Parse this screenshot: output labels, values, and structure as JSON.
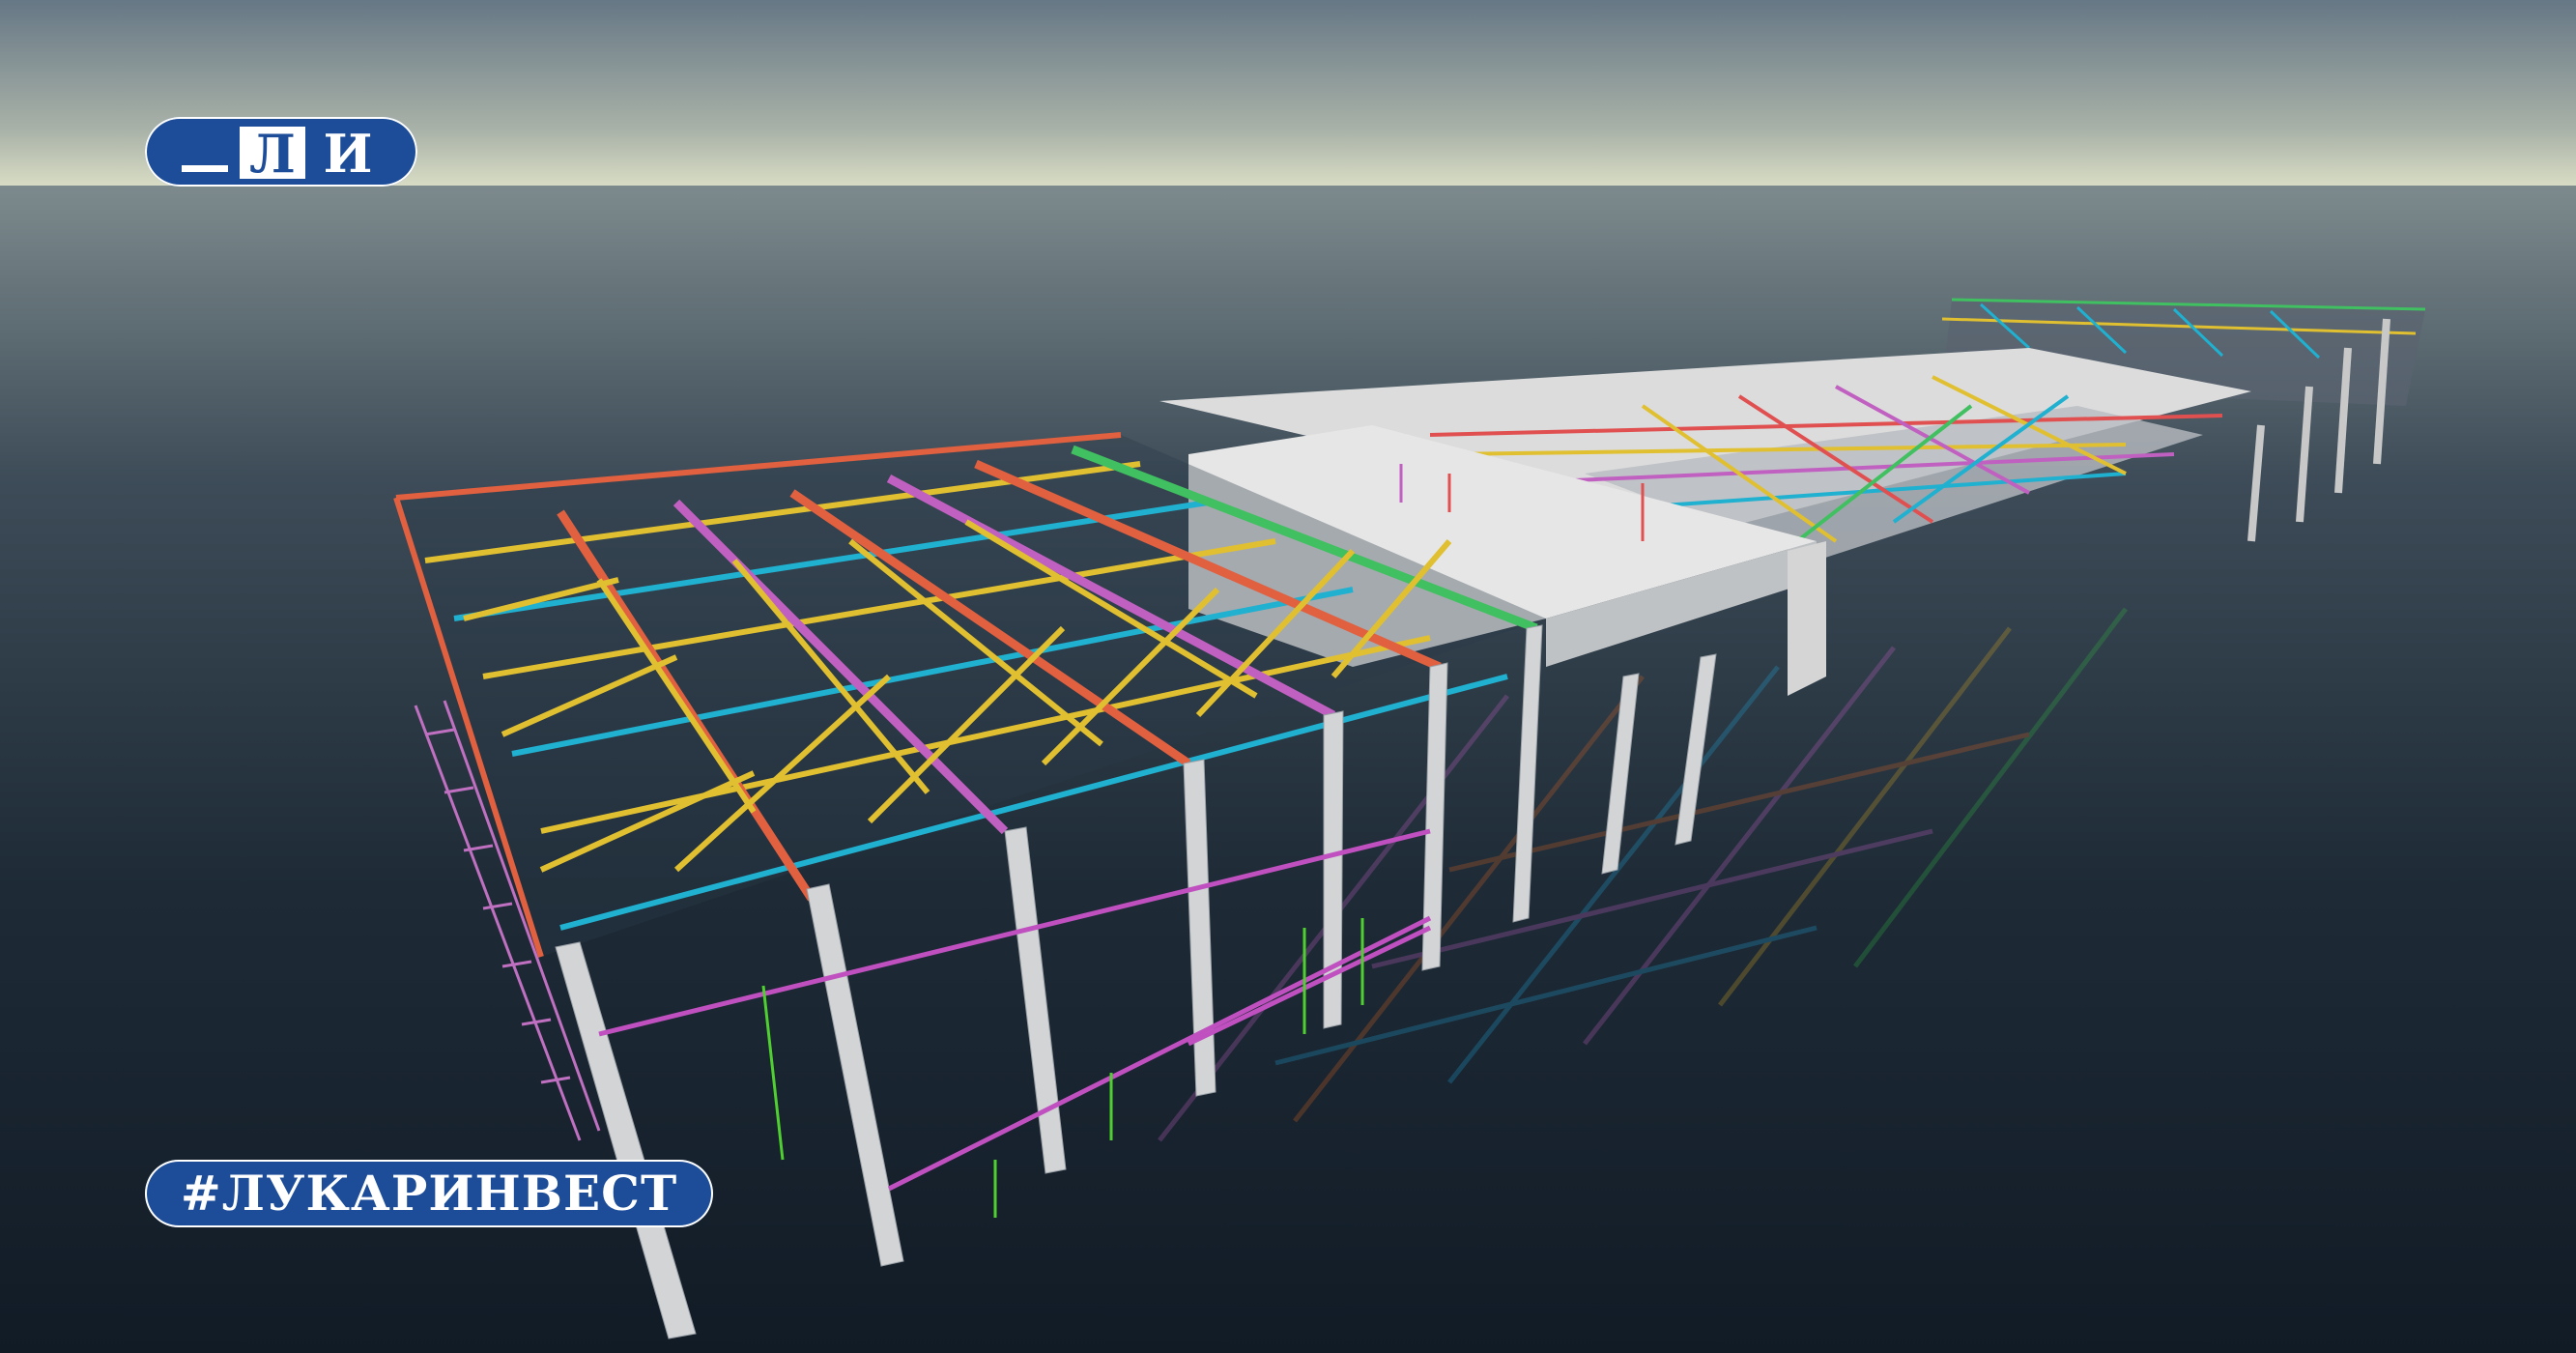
{
  "logo": {
    "box_letter": "Л",
    "right_letter": "И"
  },
  "hashtag": "#ЛУКАРИНВЕСТ",
  "colors": {
    "brand_blue": "#1d4d99",
    "sky_top": "#667785",
    "horizon": "#d8dcc4",
    "ground": "#14202c"
  }
}
